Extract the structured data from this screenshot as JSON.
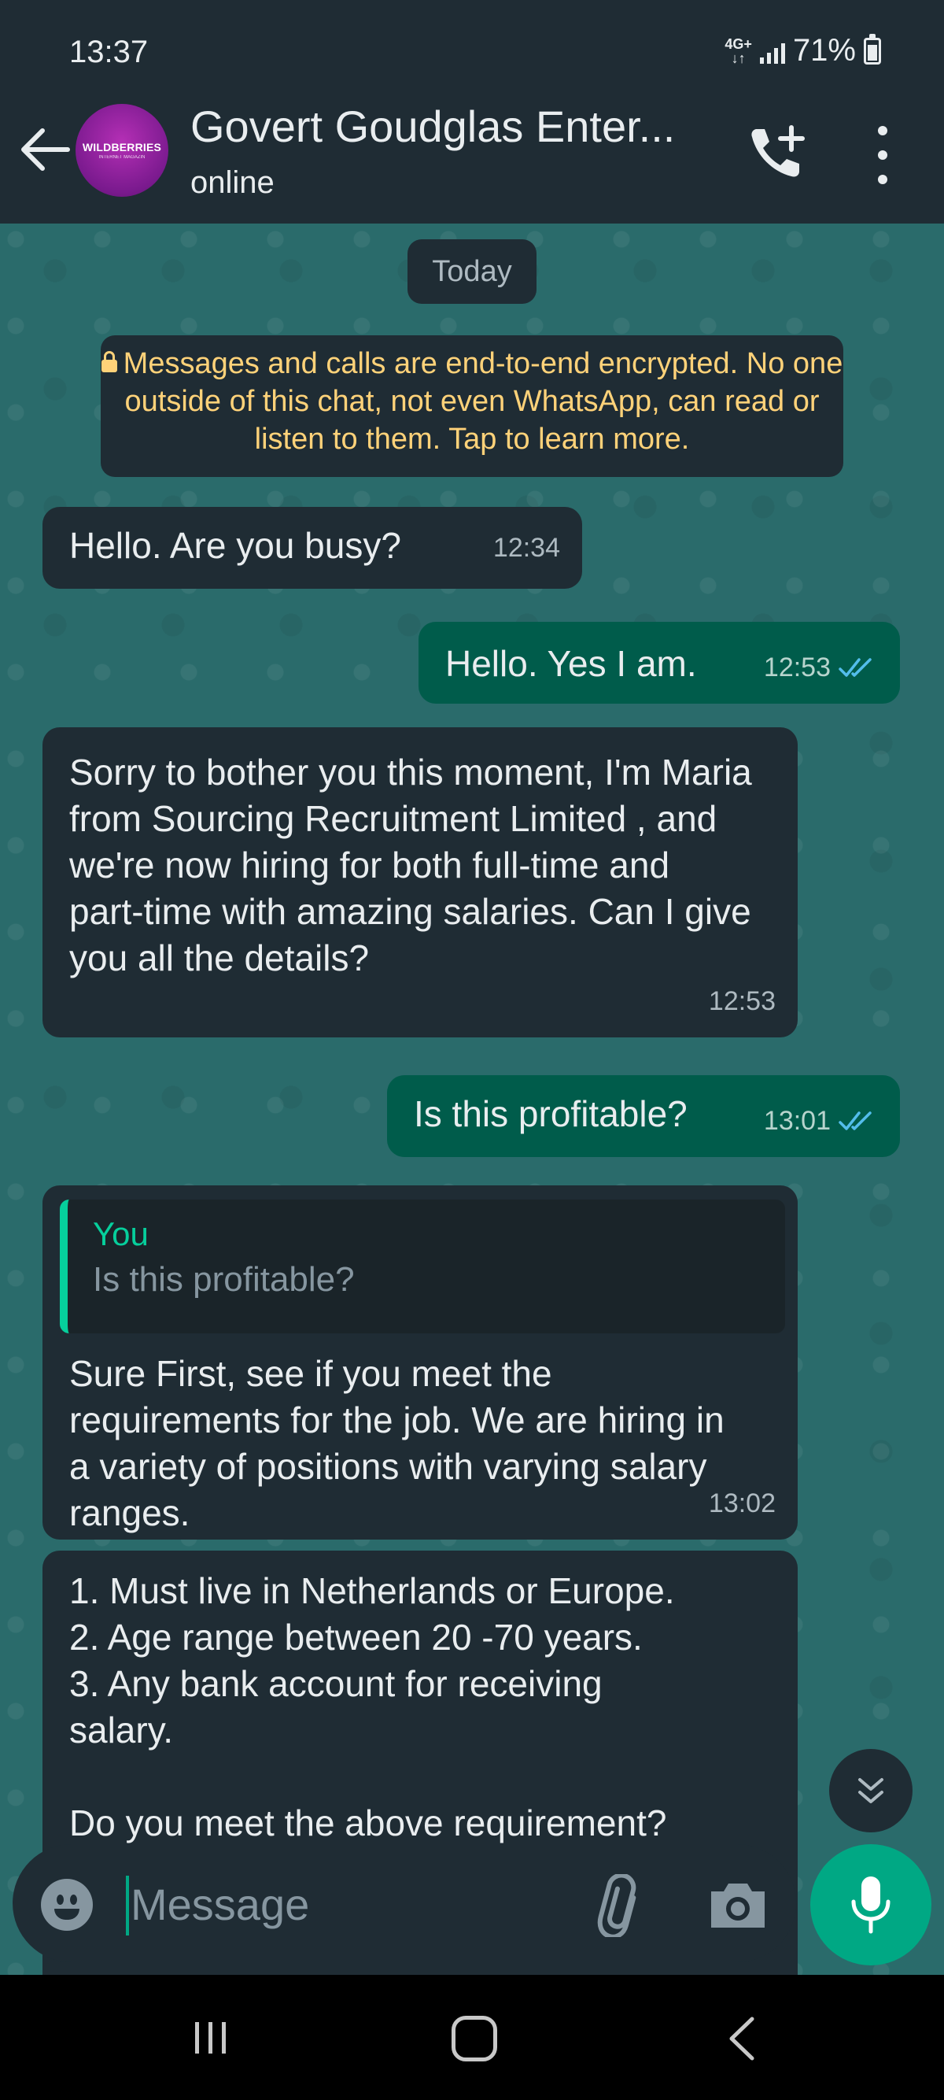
{
  "status_bar": {
    "time": "13:37",
    "network": "4G+",
    "battery": "71%"
  },
  "header": {
    "avatar_text": "WILDBERRIES",
    "avatar_subtext": "INTERNET MAGAZIN",
    "contact_name": "Govert Goudglas Enter...",
    "status": "online"
  },
  "chat": {
    "date_chip": "Today",
    "encryption_notice": "Messages and calls are end-to-end encrypted. No one outside of this chat, not even WhatsApp, can read or listen to them. Tap to learn more.",
    "messages": [
      {
        "direction": "incoming",
        "text": "Hello.  Are you busy?",
        "time": "12:34"
      },
      {
        "direction": "outgoing",
        "text": "Hello. Yes I am.",
        "time": "12:53",
        "status": "read"
      },
      {
        "direction": "incoming",
        "text": "Sorry to bother you this moment, I'm Maria from Sourcing Recruitment Limited , and we're now hiring for both full-time and part-time with amazing salaries.  Can I give you all the details?",
        "time": "12:53"
      },
      {
        "direction": "outgoing",
        "text": "Is this profitable?",
        "time": "13:01",
        "status": "read"
      },
      {
        "direction": "incoming",
        "quote_author": "You",
        "quote_text": "Is this profitable?",
        "text": "Sure First, see if you meet the requirements for the job. We are hiring in a variety of positions with varying salary ranges.",
        "time": "13:02"
      },
      {
        "direction": "incoming",
        "lines": [
          "1. Must live in Netherlands or Europe.",
          "2. Age range between 20 -70 years.",
          "3. Any bank account for receiving salary.",
          "",
          "Do you meet the above requirement?"
        ]
      }
    ]
  },
  "composer": {
    "placeholder": "Message"
  },
  "colors": {
    "header": "#1f2c34",
    "incoming": "#1f2c34",
    "outgoing": "#005c4b",
    "accent": "#00a884",
    "notice_text": "#ffd279"
  },
  "icons": [
    "back-arrow-icon",
    "add-call-icon",
    "more-options-icon",
    "lock-icon",
    "double-check-icon",
    "chevron-double-down-icon",
    "emoji-icon",
    "attach-icon",
    "camera-icon",
    "mic-icon",
    "nav-recent-icon",
    "nav-home-icon",
    "nav-back-icon"
  ]
}
